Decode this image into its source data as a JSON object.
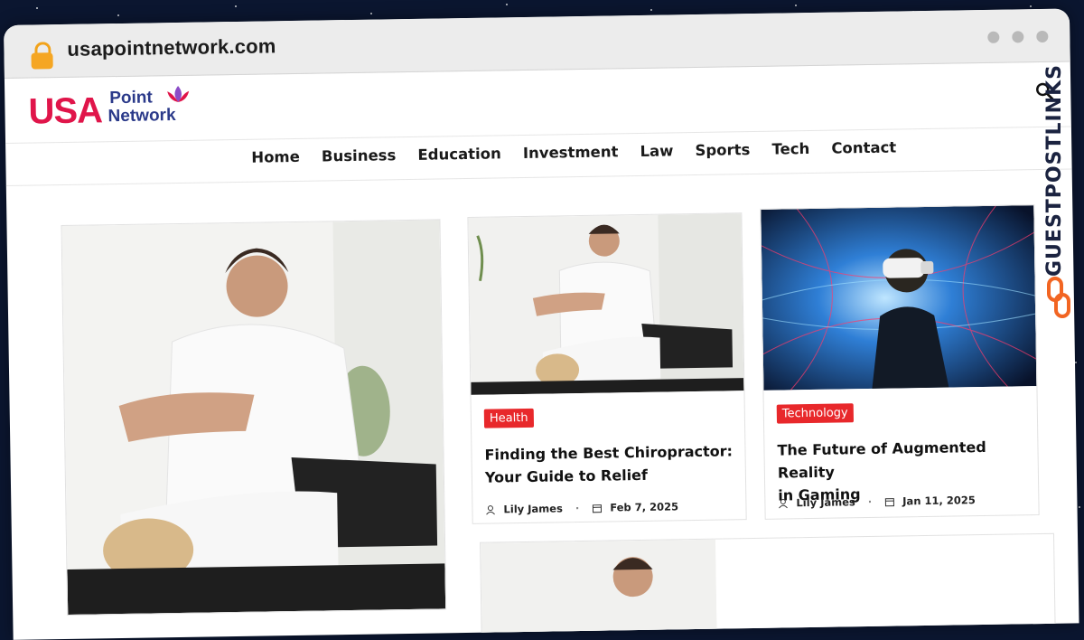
{
  "browser": {
    "url": "usapointnetwork.com"
  },
  "site": {
    "logo_main": "USA",
    "logo_top": "Point",
    "logo_bottom": "Network"
  },
  "nav": {
    "items": [
      "Home",
      "Business",
      "Education",
      "Investment",
      "Law",
      "Sports",
      "Tech",
      "Contact"
    ]
  },
  "posts": [
    {
      "category": "Health",
      "title_line1": "Finding the Best Chiropractor:",
      "title_line2": "Your Guide to Relief",
      "author": "Lily James",
      "date": "Feb 7, 2025"
    },
    {
      "category": "Technology",
      "title_line1": "The Future of Augmented Reality",
      "title_line2": "in Gaming",
      "author": "Lily James",
      "date": "Jan 11, 2025"
    }
  ],
  "watermark": "GUESTPOSTLINKS",
  "colors": {
    "badge": "#e8282b",
    "logo_red": "#e0154a",
    "logo_blue": "#2b3a8a",
    "watermark_orange": "#f26522"
  }
}
